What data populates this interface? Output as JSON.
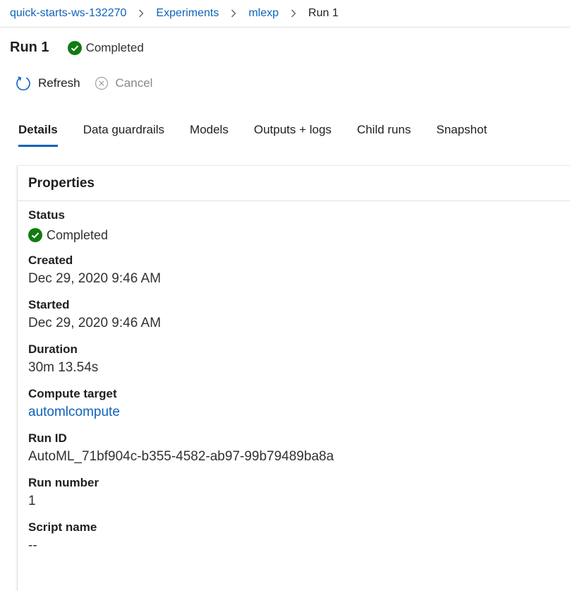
{
  "breadcrumb": {
    "workspace": "quick-starts-ws-132270",
    "experiments": "Experiments",
    "experiment": "mlexp",
    "current": "Run 1"
  },
  "header": {
    "title": "Run 1",
    "status": "Completed"
  },
  "toolbar": {
    "refresh_label": "Refresh",
    "cancel_label": "Cancel"
  },
  "tabs": [
    {
      "label": "Details",
      "active": true
    },
    {
      "label": "Data guardrails",
      "active": false
    },
    {
      "label": "Models",
      "active": false
    },
    {
      "label": "Outputs + logs",
      "active": false
    },
    {
      "label": "Child runs",
      "active": false
    },
    {
      "label": "Snapshot",
      "active": false
    }
  ],
  "properties": {
    "title": "Properties",
    "status_label": "Status",
    "status_value": "Completed",
    "created_label": "Created",
    "created_value": "Dec 29, 2020 9:46 AM",
    "started_label": "Started",
    "started_value": "Dec 29, 2020 9:46 AM",
    "duration_label": "Duration",
    "duration_value": "30m 13.54s",
    "compute_label": "Compute target",
    "compute_value": "automlcompute",
    "runid_label": "Run ID",
    "runid_value": "AutoML_71bf904c-b355-4582-ab97-99b79489ba8a",
    "runnumber_label": "Run number",
    "runnumber_value": "1",
    "script_label": "Script name",
    "script_value": "--"
  },
  "colors": {
    "accent": "#0f62ba",
    "success": "#107c10",
    "disabled": "#8a8886"
  },
  "icons": [
    "chevron-right-icon",
    "check-circle-icon",
    "refresh-icon",
    "cancel-circle-icon"
  ]
}
